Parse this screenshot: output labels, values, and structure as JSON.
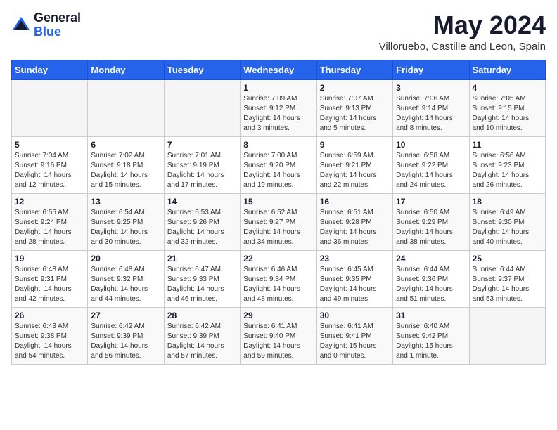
{
  "header": {
    "logo_general": "General",
    "logo_blue": "Blue",
    "title": "May 2024",
    "location": "Villoruebo, Castille and Leon, Spain"
  },
  "calendar": {
    "weekdays": [
      "Sunday",
      "Monday",
      "Tuesday",
      "Wednesday",
      "Thursday",
      "Friday",
      "Saturday"
    ],
    "weeks": [
      [
        {
          "day": "",
          "info": ""
        },
        {
          "day": "",
          "info": ""
        },
        {
          "day": "",
          "info": ""
        },
        {
          "day": "1",
          "info": "Sunrise: 7:09 AM\nSunset: 9:12 PM\nDaylight: 14 hours\nand 3 minutes."
        },
        {
          "day": "2",
          "info": "Sunrise: 7:07 AM\nSunset: 9:13 PM\nDaylight: 14 hours\nand 5 minutes."
        },
        {
          "day": "3",
          "info": "Sunrise: 7:06 AM\nSunset: 9:14 PM\nDaylight: 14 hours\nand 8 minutes."
        },
        {
          "day": "4",
          "info": "Sunrise: 7:05 AM\nSunset: 9:15 PM\nDaylight: 14 hours\nand 10 minutes."
        }
      ],
      [
        {
          "day": "5",
          "info": "Sunrise: 7:04 AM\nSunset: 9:16 PM\nDaylight: 14 hours\nand 12 minutes."
        },
        {
          "day": "6",
          "info": "Sunrise: 7:02 AM\nSunset: 9:18 PM\nDaylight: 14 hours\nand 15 minutes."
        },
        {
          "day": "7",
          "info": "Sunrise: 7:01 AM\nSunset: 9:19 PM\nDaylight: 14 hours\nand 17 minutes."
        },
        {
          "day": "8",
          "info": "Sunrise: 7:00 AM\nSunset: 9:20 PM\nDaylight: 14 hours\nand 19 minutes."
        },
        {
          "day": "9",
          "info": "Sunrise: 6:59 AM\nSunset: 9:21 PM\nDaylight: 14 hours\nand 22 minutes."
        },
        {
          "day": "10",
          "info": "Sunrise: 6:58 AM\nSunset: 9:22 PM\nDaylight: 14 hours\nand 24 minutes."
        },
        {
          "day": "11",
          "info": "Sunrise: 6:56 AM\nSunset: 9:23 PM\nDaylight: 14 hours\nand 26 minutes."
        }
      ],
      [
        {
          "day": "12",
          "info": "Sunrise: 6:55 AM\nSunset: 9:24 PM\nDaylight: 14 hours\nand 28 minutes."
        },
        {
          "day": "13",
          "info": "Sunrise: 6:54 AM\nSunset: 9:25 PM\nDaylight: 14 hours\nand 30 minutes."
        },
        {
          "day": "14",
          "info": "Sunrise: 6:53 AM\nSunset: 9:26 PM\nDaylight: 14 hours\nand 32 minutes."
        },
        {
          "day": "15",
          "info": "Sunrise: 6:52 AM\nSunset: 9:27 PM\nDaylight: 14 hours\nand 34 minutes."
        },
        {
          "day": "16",
          "info": "Sunrise: 6:51 AM\nSunset: 9:28 PM\nDaylight: 14 hours\nand 36 minutes."
        },
        {
          "day": "17",
          "info": "Sunrise: 6:50 AM\nSunset: 9:29 PM\nDaylight: 14 hours\nand 38 minutes."
        },
        {
          "day": "18",
          "info": "Sunrise: 6:49 AM\nSunset: 9:30 PM\nDaylight: 14 hours\nand 40 minutes."
        }
      ],
      [
        {
          "day": "19",
          "info": "Sunrise: 6:48 AM\nSunset: 9:31 PM\nDaylight: 14 hours\nand 42 minutes."
        },
        {
          "day": "20",
          "info": "Sunrise: 6:48 AM\nSunset: 9:32 PM\nDaylight: 14 hours\nand 44 minutes."
        },
        {
          "day": "21",
          "info": "Sunrise: 6:47 AM\nSunset: 9:33 PM\nDaylight: 14 hours\nand 46 minutes."
        },
        {
          "day": "22",
          "info": "Sunrise: 6:46 AM\nSunset: 9:34 PM\nDaylight: 14 hours\nand 48 minutes."
        },
        {
          "day": "23",
          "info": "Sunrise: 6:45 AM\nSunset: 9:35 PM\nDaylight: 14 hours\nand 49 minutes."
        },
        {
          "day": "24",
          "info": "Sunrise: 6:44 AM\nSunset: 9:36 PM\nDaylight: 14 hours\nand 51 minutes."
        },
        {
          "day": "25",
          "info": "Sunrise: 6:44 AM\nSunset: 9:37 PM\nDaylight: 14 hours\nand 53 minutes."
        }
      ],
      [
        {
          "day": "26",
          "info": "Sunrise: 6:43 AM\nSunset: 9:38 PM\nDaylight: 14 hours\nand 54 minutes."
        },
        {
          "day": "27",
          "info": "Sunrise: 6:42 AM\nSunset: 9:39 PM\nDaylight: 14 hours\nand 56 minutes."
        },
        {
          "day": "28",
          "info": "Sunrise: 6:42 AM\nSunset: 9:39 PM\nDaylight: 14 hours\nand 57 minutes."
        },
        {
          "day": "29",
          "info": "Sunrise: 6:41 AM\nSunset: 9:40 PM\nDaylight: 14 hours\nand 59 minutes."
        },
        {
          "day": "30",
          "info": "Sunrise: 6:41 AM\nSunset: 9:41 PM\nDaylight: 15 hours\nand 0 minutes."
        },
        {
          "day": "31",
          "info": "Sunrise: 6:40 AM\nSunset: 9:42 PM\nDaylight: 15 hours\nand 1 minute."
        },
        {
          "day": "",
          "info": ""
        }
      ]
    ]
  }
}
